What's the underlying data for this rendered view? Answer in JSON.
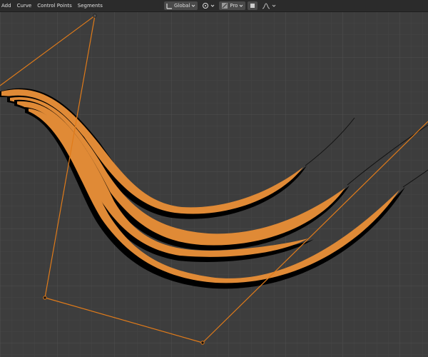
{
  "header": {
    "menus": [
      "Add",
      "Curve",
      "Control Points",
      "Segments"
    ],
    "transform_orientation": "Global",
    "pivot_label": "",
    "proportional_label": "Pro"
  },
  "colors": {
    "viewport_bg": "#3d3d3d",
    "grid_minor": "#454545",
    "grid_major": "#505050",
    "curve_fill": "#e08a36",
    "curve_shadow": "#000000",
    "handle_line": "#e07b1a"
  }
}
